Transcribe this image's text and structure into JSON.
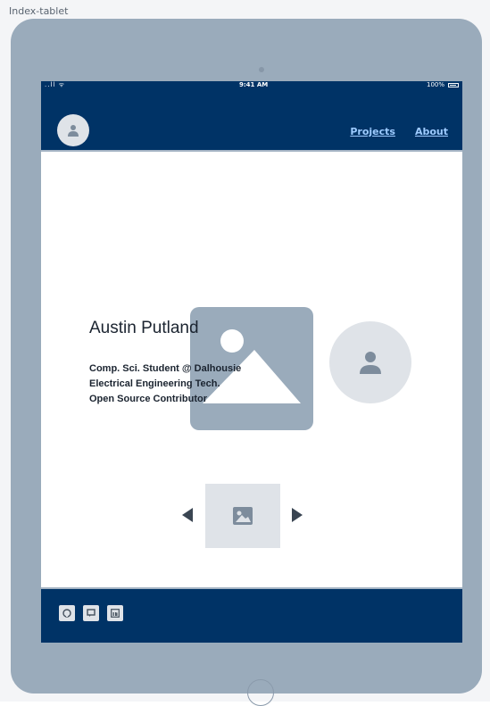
{
  "frame": {
    "label": "Index-tablet"
  },
  "status_bar": {
    "signal": "..ll",
    "wifi": "ᯤ",
    "time": "9:41 AM",
    "battery": "100%"
  },
  "nav": {
    "links": [
      "Projects",
      "About"
    ]
  },
  "hero": {
    "name": "Austin Putland",
    "lines": [
      "Comp. Sci. Student @ Dalhousie",
      "Electrical Engineering Tech.",
      "Open Source Contributor"
    ]
  },
  "footer": {
    "social_icons": [
      "github-icon",
      "chat-icon",
      "linkedin-icon"
    ]
  },
  "colors": {
    "brand": "#003366",
    "device": "#9aabbb",
    "placeholder": "#dfe3e8",
    "link": "#9ecbff"
  }
}
